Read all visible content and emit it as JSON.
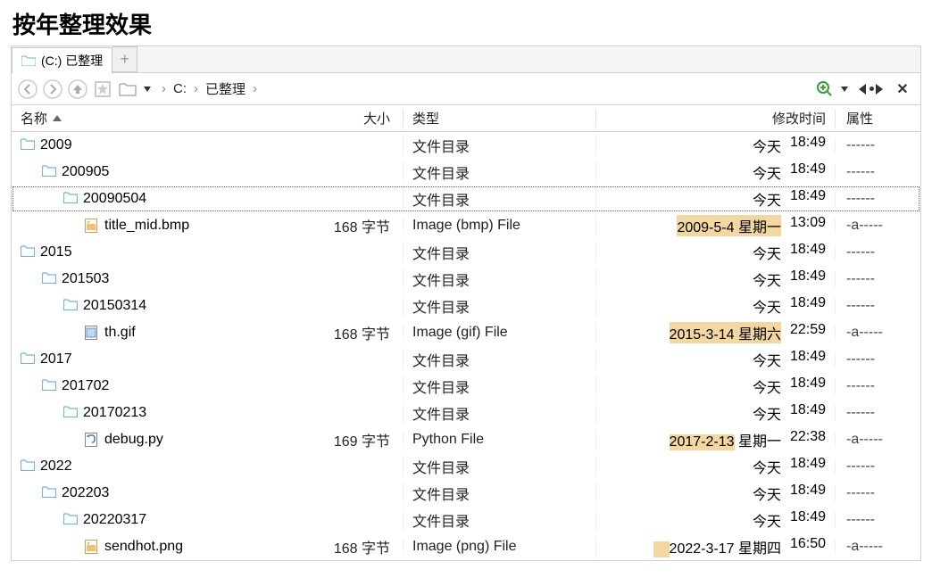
{
  "page_title": "按年整理效果",
  "tab": {
    "label": "(C:) 已整理"
  },
  "breadcrumb": {
    "drive": "C:",
    "folder": "已整理"
  },
  "columns": {
    "name": "名称",
    "size": "大小",
    "type": "类型",
    "date": "修改时间",
    "attr": "属性"
  },
  "rows": [
    {
      "indent": 0,
      "kind": "folder",
      "name": "2009",
      "size": "",
      "type": "文件目录",
      "date": "今天",
      "time": "18:49",
      "attr": "------",
      "hl": false
    },
    {
      "indent": 1,
      "kind": "folder",
      "name": "200905",
      "size": "",
      "type": "文件目录",
      "date": "今天",
      "time": "18:49",
      "attr": "------",
      "hl": false
    },
    {
      "indent": 2,
      "kind": "folder",
      "name": "20090504",
      "size": "",
      "type": "文件目录",
      "date": "今天",
      "time": "18:49",
      "attr": "------",
      "hl": false,
      "selected": true
    },
    {
      "indent": 3,
      "kind": "bmp",
      "name": "title_mid.bmp",
      "size": "168 字节",
      "type": "Image (bmp) File",
      "date": "2009-5-4 星期一",
      "time": "13:09",
      "attr": "-a-----",
      "hl": true
    },
    {
      "indent": 0,
      "kind": "folder",
      "name": "2015",
      "size": "",
      "type": "文件目录",
      "date": "今天",
      "time": "18:49",
      "attr": "------",
      "hl": false
    },
    {
      "indent": 1,
      "kind": "folder",
      "name": "201503",
      "size": "",
      "type": "文件目录",
      "date": "今天",
      "time": "18:49",
      "attr": "------",
      "hl": false
    },
    {
      "indent": 2,
      "kind": "folder",
      "name": "20150314",
      "size": "",
      "type": "文件目录",
      "date": "今天",
      "time": "18:49",
      "attr": "------",
      "hl": false
    },
    {
      "indent": 3,
      "kind": "gif",
      "name": "th.gif",
      "size": "168 字节",
      "type": "Image (gif) File",
      "date": "2015-3-14 星期六",
      "time": "22:59",
      "attr": "-a-----",
      "hl": true
    },
    {
      "indent": 0,
      "kind": "folder",
      "name": "2017",
      "size": "",
      "type": "文件目录",
      "date": "今天",
      "time": "18:49",
      "attr": "------",
      "hl": false
    },
    {
      "indent": 1,
      "kind": "folder",
      "name": "201702",
      "size": "",
      "type": "文件目录",
      "date": "今天",
      "time": "18:49",
      "attr": "------",
      "hl": false
    },
    {
      "indent": 2,
      "kind": "folder",
      "name": "20170213",
      "size": "",
      "type": "文件目录",
      "date": "今天",
      "time": "18:49",
      "attr": "------",
      "hl": false
    },
    {
      "indent": 3,
      "kind": "py",
      "name": "debug.py",
      "size": "169 字节",
      "type": "Python File",
      "date": "2017-2-13 星期一",
      "time": "22:38",
      "attr": "-a-----",
      "hl": true,
      "hlshort": true
    },
    {
      "indent": 0,
      "kind": "folder",
      "name": "2022",
      "size": "",
      "type": "文件目录",
      "date": "今天",
      "time": "18:49",
      "attr": "------",
      "hl": false
    },
    {
      "indent": 1,
      "kind": "folder",
      "name": "202203",
      "size": "",
      "type": "文件目录",
      "date": "今天",
      "time": "18:49",
      "attr": "------",
      "hl": false
    },
    {
      "indent": 2,
      "kind": "folder",
      "name": "20220317",
      "size": "",
      "type": "文件目录",
      "date": "今天",
      "time": "18:49",
      "attr": "------",
      "hl": false
    },
    {
      "indent": 3,
      "kind": "png",
      "name": "sendhot.png",
      "size": "168 字节",
      "type": "Image (png) File",
      "date": "2022-3-17 星期四",
      "time": "16:50",
      "attr": "-a-----",
      "hl": true,
      "hlveryshort": true
    }
  ]
}
